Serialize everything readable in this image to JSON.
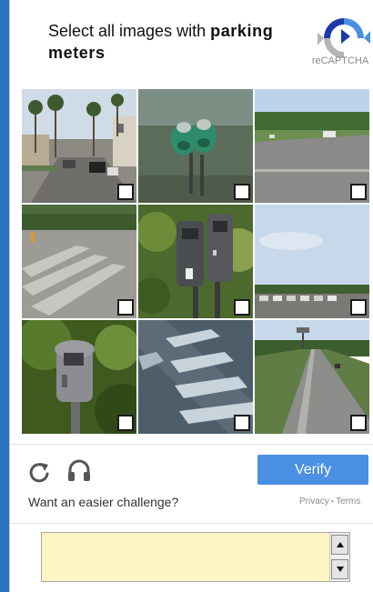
{
  "header": {
    "prompt_prefix": "Select all images with",
    "prompt_target": "parking meters",
    "logo_text": "reCAPTCHA"
  },
  "grid": {
    "tiles": [
      {
        "scene": "palm-tree-street"
      },
      {
        "scene": "parking-meter-aerial"
      },
      {
        "scene": "road-grass"
      },
      {
        "scene": "crosswalk-road"
      },
      {
        "scene": "double-parking-meter"
      },
      {
        "scene": "sky-parking-lot"
      },
      {
        "scene": "single-parking-meter"
      },
      {
        "scene": "crosswalk-closeup"
      },
      {
        "scene": "highway"
      }
    ]
  },
  "controls": {
    "reload_icon": "reload-icon",
    "audio_icon": "headphones-icon",
    "verify_label": "Verify",
    "easier_challenge": "Want an easier challenge?",
    "privacy": "Privacy",
    "separator": "-",
    "terms": "Terms"
  },
  "colors": {
    "verify": "#4a90e2",
    "textarea_bg": "#fff4c4",
    "side_bar": "#2a72c4"
  }
}
